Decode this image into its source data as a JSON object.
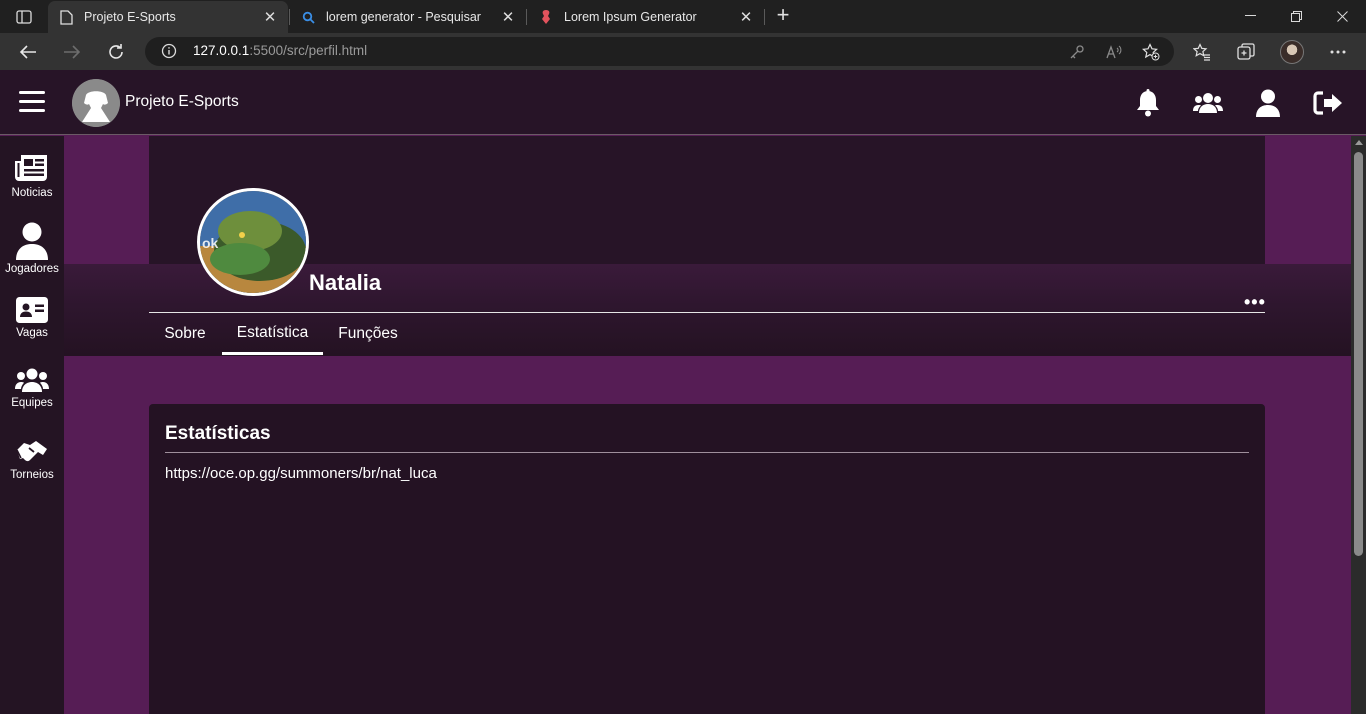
{
  "browser": {
    "tabs": [
      {
        "title": "Projeto E-Sports",
        "icon": "page-icon",
        "active": true
      },
      {
        "title": "lorem generator - Pesquisar",
        "icon": "search-icon",
        "active": false
      },
      {
        "title": "Lorem Ipsum Generator",
        "icon": "lorem-ipsum-icon",
        "active": false
      }
    ],
    "close_glyph": "✕",
    "new_tab_glyph": "+",
    "url_host": "127.0.0.1",
    "url_rest": ":5500/src/perfil.html"
  },
  "app": {
    "brand": "Projeto E-Sports"
  },
  "sidebar": {
    "items": [
      {
        "label": "Noticias",
        "icon": "newspaper-icon"
      },
      {
        "label": "Jogadores",
        "icon": "user-icon"
      },
      {
        "label": "Vagas",
        "icon": "id-card-icon"
      },
      {
        "label": "Equipes",
        "icon": "users-icon"
      },
      {
        "label": "Torneios",
        "icon": "handshake-icon"
      }
    ]
  },
  "profile": {
    "name": "Natalia",
    "avatar_text": "ok",
    "more_glyph": "•••",
    "tabs": [
      {
        "label": "Sobre",
        "active": false
      },
      {
        "label": "Estatística",
        "active": true
      },
      {
        "label": "Funções",
        "active": false
      }
    ]
  },
  "card": {
    "title": "Estatísticas",
    "link": "https://oce.op.gg/summoners/br/nat_luca"
  }
}
